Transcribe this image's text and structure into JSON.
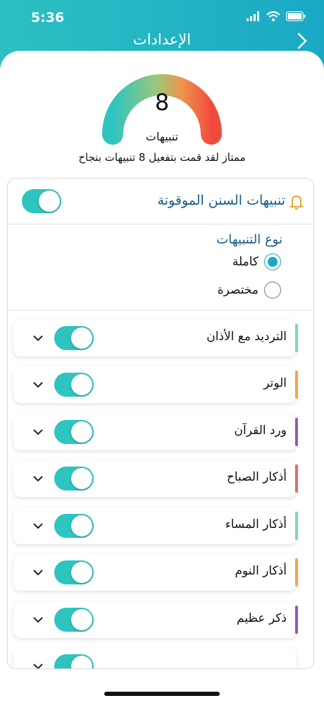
{
  "status": {
    "time": "5:36"
  },
  "header": {
    "title": "الإعدادات"
  },
  "gauge": {
    "value": "8",
    "label": "تنبيهات",
    "success_text": "ممتاز لقد قمت بتفعيل 8 تنبيهات بنجاح"
  },
  "section": {
    "title": "تنبيهات السنن الموقوتة",
    "enabled": true,
    "type_title": "نوع التنبيهات",
    "options": [
      {
        "label": "كاملة",
        "selected": true
      },
      {
        "label": "مختصرة",
        "selected": false
      }
    ]
  },
  "items": [
    {
      "label": "الترديد مع الأذان",
      "enabled": true,
      "color": "#7fd3c2"
    },
    {
      "label": "الوتر",
      "enabled": true,
      "color": "#f3a64a"
    },
    {
      "label": "ورد القرآن",
      "enabled": true,
      "color": "#8b5bb8"
    },
    {
      "label": "أذكار الصباح",
      "enabled": true,
      "color": "#e06a6a"
    },
    {
      "label": "أذكار المساء",
      "enabled": true,
      "color": "#7fd3c2"
    },
    {
      "label": "أذكار النوم",
      "enabled": true,
      "color": "#f3a64a"
    },
    {
      "label": "ذكر عظيم",
      "enabled": true,
      "color": "#8b5bb8"
    }
  ],
  "colors": {
    "accent": "#2ec4c0",
    "header": "#1aa9c5",
    "title_blue": "#1a5a88"
  }
}
